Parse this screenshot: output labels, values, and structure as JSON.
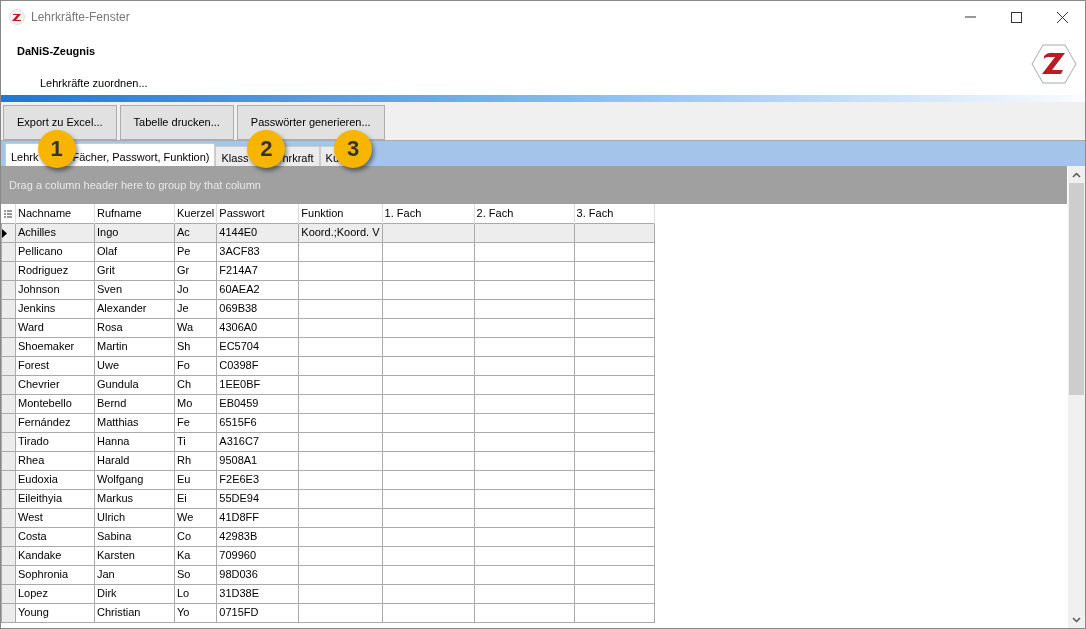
{
  "window": {
    "title": "Lehrkräfte-Fenster"
  },
  "header": {
    "title": "DaNiS-Zeugnis",
    "subtitle": "Lehrkräfte zuordnen..."
  },
  "toolbar": {
    "buttons": [
      "Export zu Excel...",
      "Tabelle drucken...",
      "Passwörter generieren..."
    ]
  },
  "tabs": [
    {
      "label_parts": [
        "Lehrk",
        "Fächer, Passwort, Funktion)"
      ],
      "selected": true
    },
    {
      "label_parts": [
        "Klass",
        "hrkraft"
      ],
      "selected": false
    },
    {
      "label_parts": [
        "Ku"
      ],
      "selected": false
    }
  ],
  "callouts": [
    {
      "label": "1"
    },
    {
      "label": "2"
    },
    {
      "label": "3"
    }
  ],
  "group_panel": {
    "hint": "Drag a column header here to group by that column"
  },
  "table": {
    "columns": [
      "Nachname",
      "Rufname",
      "Kuerzel",
      "Passwort",
      "Funktion",
      "1. Fach",
      "2. Fach",
      "3. Fach"
    ],
    "rows": [
      {
        "cells": [
          "Achilles",
          "Ingo",
          "Ac",
          "4144E0",
          "Koord.;Koord. V",
          "",
          "",
          ""
        ],
        "selected": true
      },
      {
        "cells": [
          "Pellicano",
          "Olaf",
          "Pe",
          "3ACF83",
          "",
          "",
          "",
          ""
        ],
        "selected": false
      },
      {
        "cells": [
          "Rodriguez",
          "Grit",
          "Gr",
          "F214A7",
          "",
          "",
          "",
          ""
        ],
        "selected": false
      },
      {
        "cells": [
          "Johnson",
          "Sven",
          "Jo",
          "60AEA2",
          "",
          "",
          "",
          ""
        ],
        "selected": false
      },
      {
        "cells": [
          "Jenkins",
          "Alexander",
          "Je",
          "069B38",
          "",
          "",
          "",
          ""
        ],
        "selected": false
      },
      {
        "cells": [
          "Ward",
          "Rosa",
          "Wa",
          "4306A0",
          "",
          "",
          "",
          ""
        ],
        "selected": false
      },
      {
        "cells": [
          "Shoemaker",
          "Martin",
          "Sh",
          "EC5704",
          "",
          "",
          "",
          ""
        ],
        "selected": false
      },
      {
        "cells": [
          "Forest",
          "Uwe",
          "Fo",
          "C0398F",
          "",
          "",
          "",
          ""
        ],
        "selected": false
      },
      {
        "cells": [
          "Chevrier",
          "Gundula",
          "Ch",
          "1EE0BF",
          "",
          "",
          "",
          ""
        ],
        "selected": false
      },
      {
        "cells": [
          "Montebello",
          "Bernd",
          "Mo",
          "EB0459",
          "",
          "",
          "",
          ""
        ],
        "selected": false
      },
      {
        "cells": [
          "Fernández",
          "Matthias",
          "Fe",
          "6515F6",
          "",
          "",
          "",
          ""
        ],
        "selected": false
      },
      {
        "cells": [
          "Tirado",
          "Hanna",
          "Ti",
          "A316C7",
          "",
          "",
          "",
          ""
        ],
        "selected": false
      },
      {
        "cells": [
          "Rhea",
          "Harald",
          "Rh",
          "9508A1",
          "",
          "",
          "",
          ""
        ],
        "selected": false
      },
      {
        "cells": [
          "Eudoxia",
          "Wolfgang",
          "Eu",
          "F2E6E3",
          "",
          "",
          "",
          ""
        ],
        "selected": false
      },
      {
        "cells": [
          "Eileithyia",
          "Markus",
          "Ei",
          "55DE94",
          "",
          "",
          "",
          ""
        ],
        "selected": false
      },
      {
        "cells": [
          "West",
          "Ulrich",
          "We",
          "41D8FF",
          "",
          "",
          "",
          ""
        ],
        "selected": false
      },
      {
        "cells": [
          "Costa",
          "Sabina",
          "Co",
          "42983B",
          "",
          "",
          "",
          ""
        ],
        "selected": false
      },
      {
        "cells": [
          "Kandake",
          "Karsten",
          "Ka",
          "709960",
          "",
          "",
          "",
          ""
        ],
        "selected": false
      },
      {
        "cells": [
          "Sophronia",
          "Jan",
          "So",
          "98D036",
          "",
          "",
          "",
          ""
        ],
        "selected": false
      },
      {
        "cells": [
          "Lopez",
          "Dirk",
          "Lo",
          "31D38E",
          "",
          "",
          "",
          ""
        ],
        "selected": false
      },
      {
        "cells": [
          "Young",
          "Christian",
          "Yo",
          "0715FD",
          "",
          "",
          "",
          ""
        ],
        "selected": false
      }
    ]
  }
}
